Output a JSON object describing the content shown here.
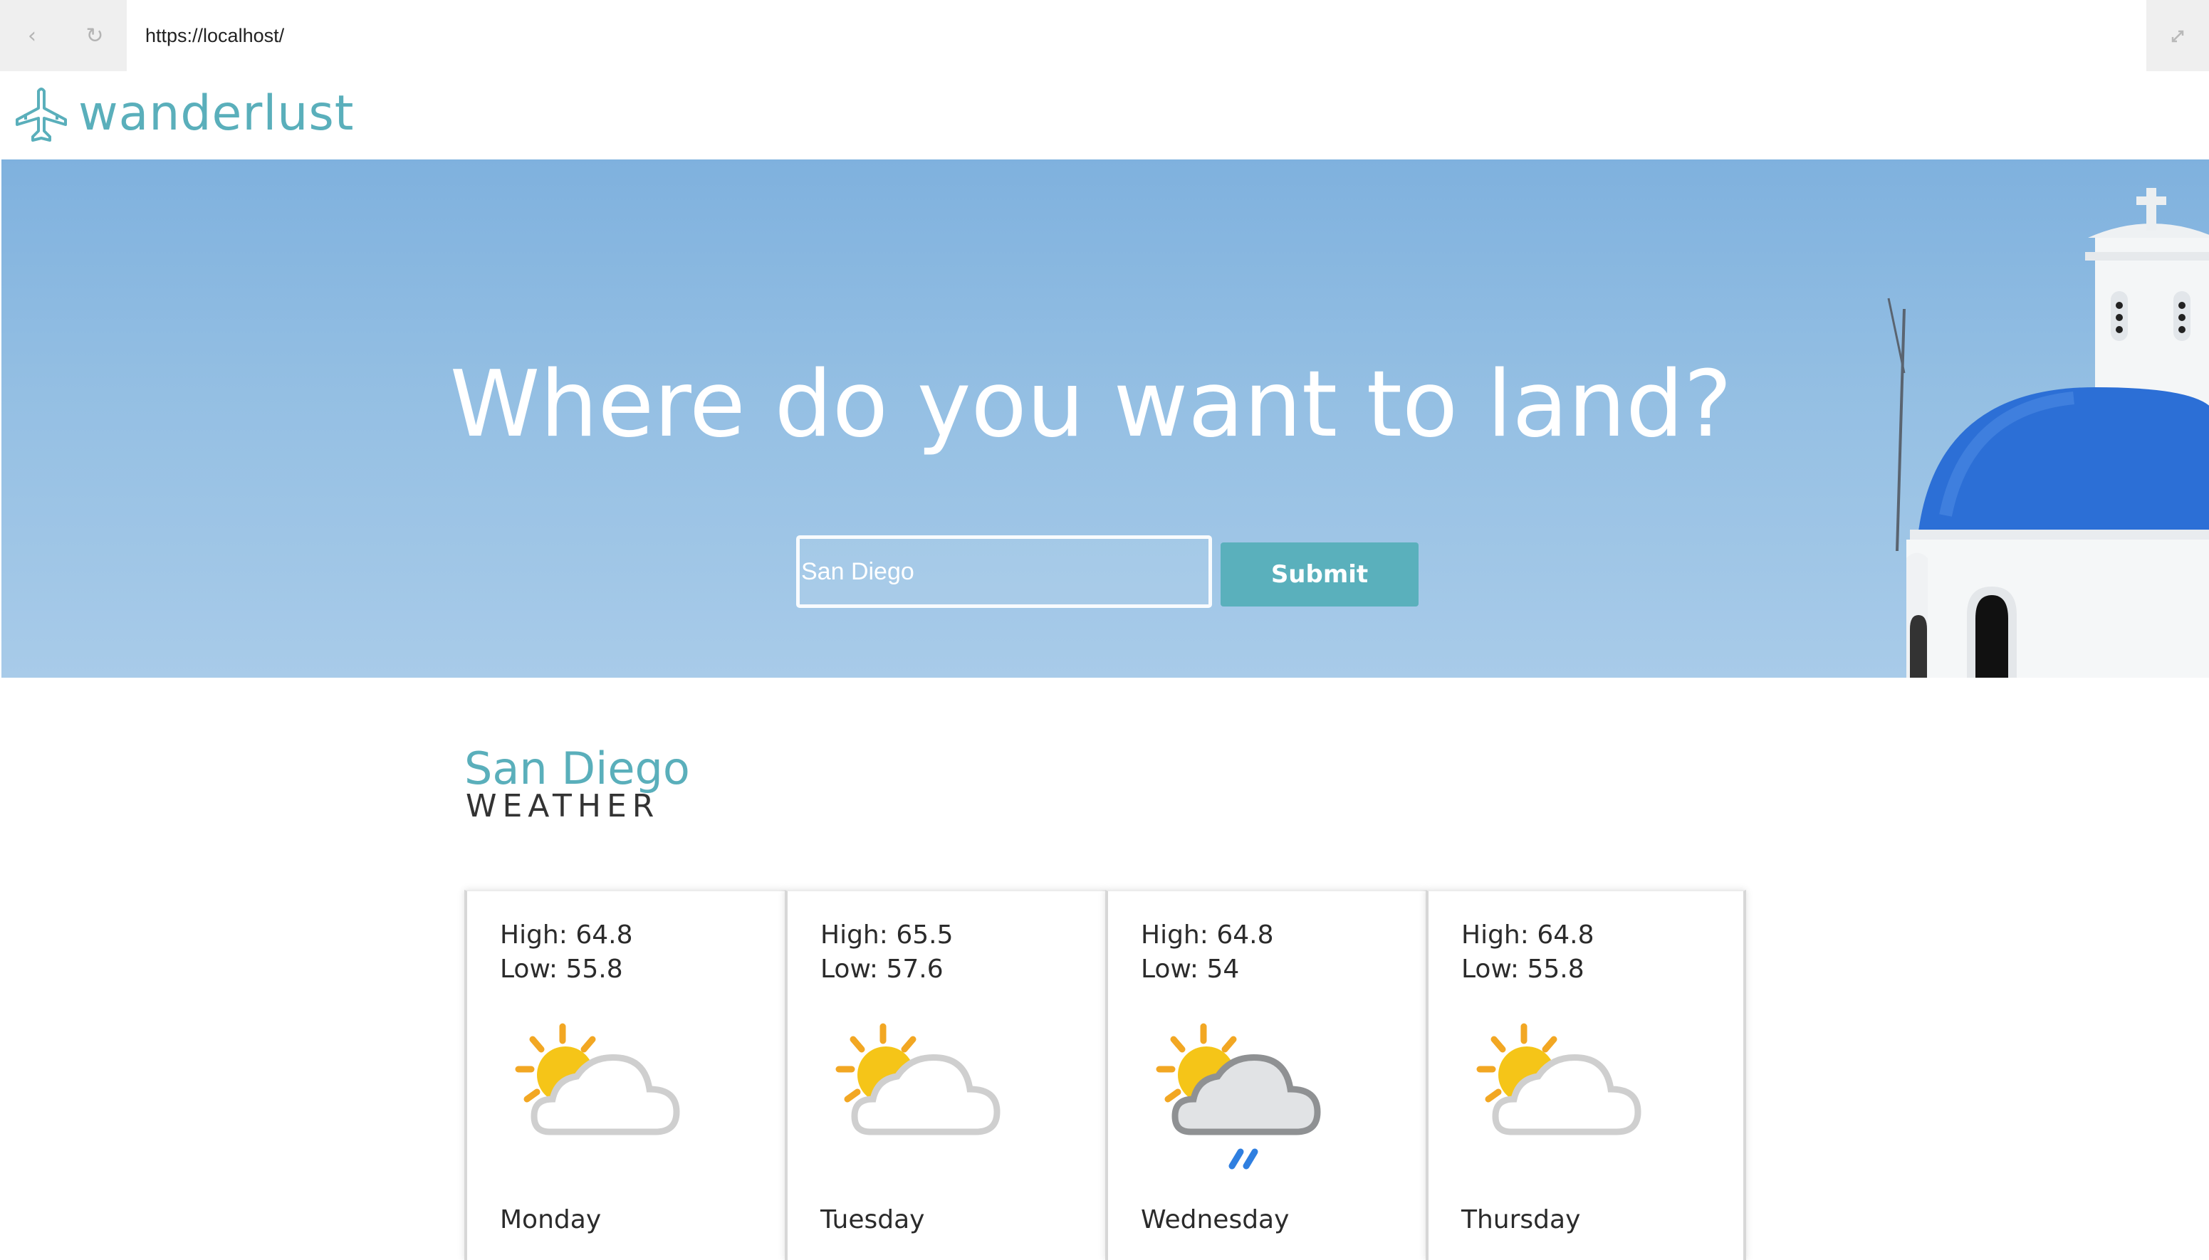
{
  "browser": {
    "url": "https://localhost/",
    "back_icon": "‹",
    "reload_icon": "↻"
  },
  "header": {
    "logo_text": "wanderlust",
    "brand_color": "#5aafbb"
  },
  "hero": {
    "title": "Where do you want to land?",
    "search_value": "San Diego",
    "submit_label": "Submit"
  },
  "weather": {
    "city": "San Diego",
    "label": "WEATHER",
    "days": [
      {
        "high": "High: 64.8",
        "low": "Low: 55.8",
        "day": "Monday",
        "icon": "partly-cloudy-icon"
      },
      {
        "high": "High: 65.5",
        "low": "Low: 57.6",
        "day": "Tuesday",
        "icon": "partly-cloudy-icon"
      },
      {
        "high": "High: 64.8",
        "low": "Low: 54",
        "day": "Wednesday",
        "icon": "rain-icon"
      },
      {
        "high": "High: 64.8",
        "low": "Low: 55.8",
        "day": "Thursday",
        "icon": "partly-cloudy-icon"
      }
    ]
  }
}
